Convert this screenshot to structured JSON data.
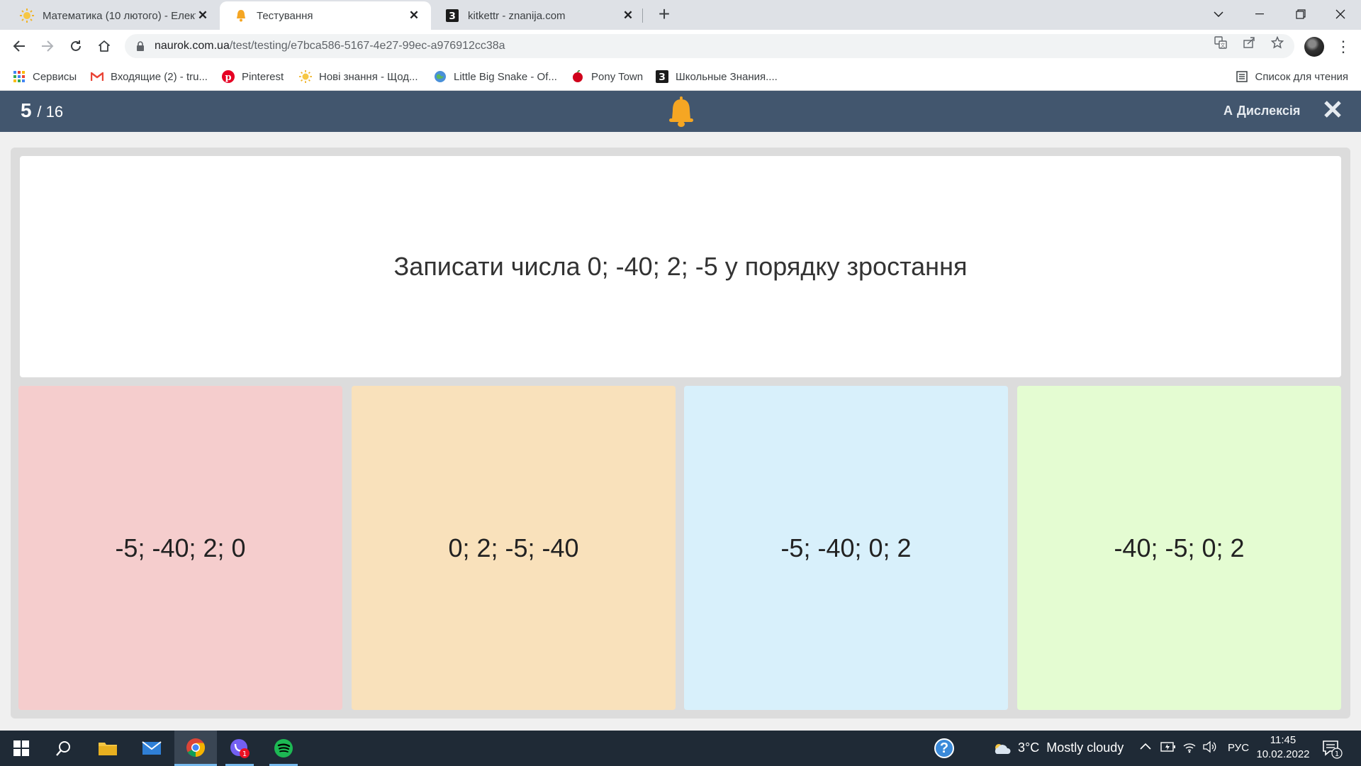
{
  "browser": {
    "tabs": [
      {
        "title": "Математика (10 лютого) - Елект",
        "icon": "sun-icon",
        "active": false
      },
      {
        "title": "Тестування",
        "icon": "bell-icon",
        "active": true
      },
      {
        "title": "kitkettr - znanija.com",
        "icon": "znanija-icon",
        "active": false
      }
    ],
    "new_tab_label": "+",
    "url_host": "naurok.com.ua",
    "url_path": "/test/testing/e7bca586-5167-4e27-99ec-a976912cc38a",
    "bookmarks": [
      {
        "label": "Сервисы",
        "icon": "apps-grid-icon"
      },
      {
        "label": "Входящие (2) - tru...",
        "icon": "gmail-icon"
      },
      {
        "label": "Pinterest",
        "icon": "pinterest-icon"
      },
      {
        "label": "Нові знання - Щод...",
        "icon": "sun-icon"
      },
      {
        "label": "Little Big Snake - Of...",
        "icon": "globe-icon"
      },
      {
        "label": "Pony Town",
        "icon": "apple-icon"
      },
      {
        "label": "Школьные Знания....",
        "icon": "znanija-icon"
      }
    ],
    "reading_list": "Список для чтения"
  },
  "quiz": {
    "current": "5",
    "total": "/ 16",
    "dyslexia_label": "Дислексія",
    "dyslexia_icon_text": "A",
    "question": "Записати числа 0; -40; 2; -5 у порядку зростання",
    "answers": [
      {
        "text": "-5; -40; 2; 0",
        "color": "#f5cdcd"
      },
      {
        "text": "0; 2; -5; -40",
        "color": "#f9e1bb"
      },
      {
        "text": "-5; -40; 0; 2",
        "color": "#d8f0fb"
      },
      {
        "text": "-40; -5; 0; 2",
        "color": "#e4fcd2"
      }
    ],
    "header_color": "#42566e",
    "bell_color": "#f5a623"
  },
  "taskbar": {
    "weather": "3°C  Mostly cloudy",
    "language": "РУС",
    "time": "11:45",
    "date": "10.02.2022",
    "viber_badge": "1",
    "notification_count": "1"
  }
}
